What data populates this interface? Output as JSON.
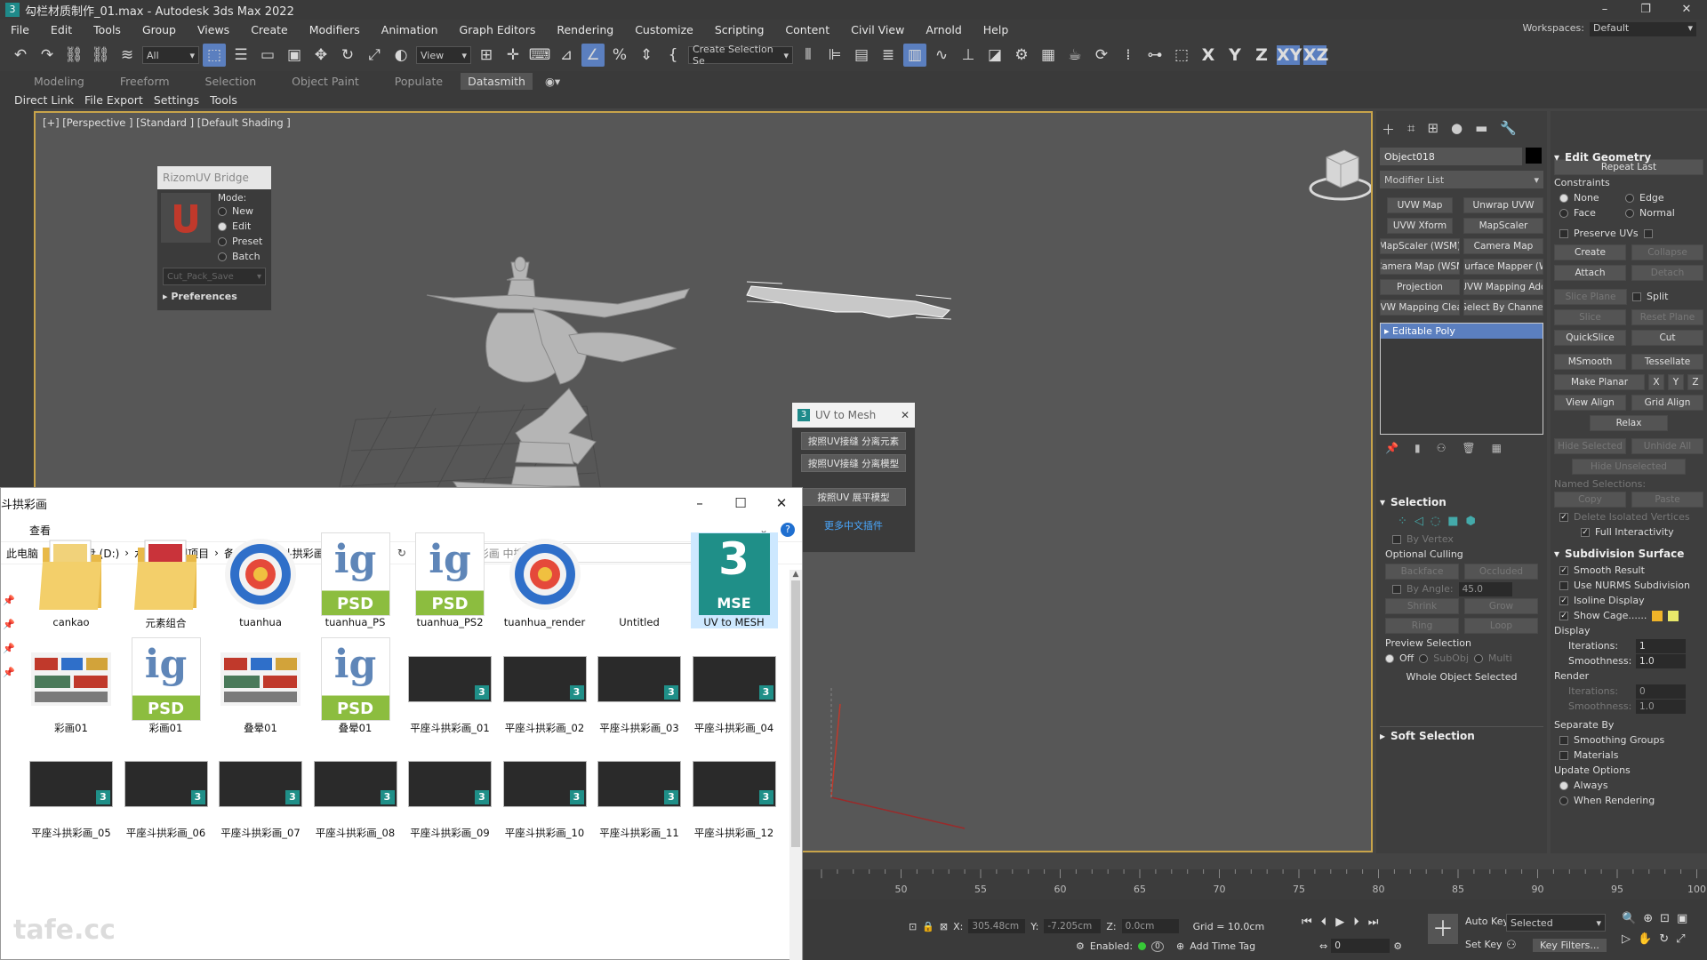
{
  "window": {
    "title": "勾栏材质制作_01.max - Autodesk 3ds Max 2022",
    "app_icon": "3",
    "controls": [
      "–",
      "❐",
      "✕"
    ]
  },
  "menu": [
    "File",
    "Edit",
    "Tools",
    "Group",
    "Views",
    "Create",
    "Modifiers",
    "Animation",
    "Graph Editors",
    "Rendering",
    "Customize",
    "Scripting",
    "Content",
    "Civil View",
    "Arnold",
    "Help"
  ],
  "workspaces": {
    "label": "Workspaces:",
    "value": "Default"
  },
  "toolbar": {
    "filter": "All",
    "view": "View",
    "selection_set": "Create Selection Se",
    "axes": [
      "X",
      "Y",
      "Z",
      "XY",
      "XZ"
    ]
  },
  "ribbon_tabs": [
    "Modeling",
    "Freeform",
    "Selection",
    "Object Paint",
    "Populate",
    "Datasmith"
  ],
  "subbar": [
    "Direct Link",
    "File Export",
    "Settings",
    "Tools"
  ],
  "viewport": {
    "label": "[+] [Perspective ] [Standard ] [Default Shading ]"
  },
  "rizom": {
    "title": "RizomUV Bridge",
    "mode_label": "Mode:",
    "modes": [
      "New",
      "Edit",
      "Preset",
      "Batch"
    ],
    "selected": "Edit",
    "dropdown": "Cut_Pack_Save",
    "preferences": "Preferences"
  },
  "uvmesh": {
    "title": "UV to Mesh",
    "buttons": [
      "按照UV接缝 分离元素",
      "按照UV接缝 分离模型",
      "按照UV 展平模型"
    ],
    "link": "更多中文插件"
  },
  "command_panel": {
    "object_name": "Object018",
    "modifier_list": "Modifier List",
    "buttons": [
      "UVW Map",
      "Unwrap UVW",
      "UVW Xform",
      "MapScaler",
      "MapScaler (WSM)",
      "Camera Map",
      "Camera Map (WSM",
      "Surface Mapper (W",
      "Projection",
      "UVW Mapping Add",
      "UVW Mapping Clear",
      "Select By Channel"
    ],
    "stack_item": "Editable Poly",
    "selection": {
      "title": "Selection",
      "by_vertex": "By Vertex",
      "optional_culling": "Optional Culling",
      "backface": "Backface",
      "occluded": "Occluded",
      "by_angle": "By Angle:",
      "angle": "45.0",
      "shrink": "Shrink",
      "grow": "Grow",
      "ring": "Ring",
      "loop": "Loop",
      "preview": "Preview Selection",
      "off": "Off",
      "subobj": "SubObj",
      "multi": "Multi",
      "status": "Whole Object Selected"
    },
    "soft_selection": "Soft Selection"
  },
  "edit_geometry": {
    "title": "Edit Geometry",
    "repeat_last": "Repeat Last",
    "constraints": "Constraints",
    "c_opts": [
      "None",
      "Edge",
      "Face",
      "Normal"
    ],
    "preserve_uvs": "Preserve UVs",
    "create": "Create",
    "collapse": "Collapse",
    "attach": "Attach",
    "detach": "Detach",
    "slice_plane": "Slice Plane",
    "split": "Split",
    "slice": "Slice",
    "reset_plane": "Reset Plane",
    "quickslice": "QuickSlice",
    "cut": "Cut",
    "msmooth": "MSmooth",
    "tessellate": "Tessellate",
    "make_planar": "Make Planar",
    "x": "X",
    "y": "Y",
    "z": "Z",
    "view_align": "View Align",
    "grid_align": "Grid Align",
    "relax": "Relax",
    "hide_selected": "Hide Selected",
    "unhide_all": "Unhide All",
    "hide_unselected": "Hide Unselected",
    "named_selections": "Named Selections:",
    "copy": "Copy",
    "paste": "Paste",
    "delete_isolated": "Delete Isolated Vertices",
    "full_interactivity": "Full Interactivity"
  },
  "subdivision": {
    "title": "Subdivision Surface",
    "smooth_result": "Smooth Result",
    "use_nurms": "Use NURMS Subdivision",
    "isoline": "Isoline Display",
    "show_cage": "Show Cage......",
    "cage_colors": [
      "#f0b429",
      "#e8e86a"
    ],
    "display": "Display",
    "iterations": "Iterations:",
    "iter_val": "1",
    "smoothness": "Smoothness:",
    "smooth_val": "1.0",
    "render": "Render",
    "r_iter_val": "0",
    "r_smooth_val": "1.0",
    "separate_by": "Separate By",
    "smoothing_groups": "Smoothing Groups",
    "materials": "Materials",
    "update_options": "Update Options",
    "always": "Always",
    "when_rendering": "When Rendering"
  },
  "explorer": {
    "title": "斗拱彩画",
    "view_tab": "查看",
    "crumbs": [
      "此电脑",
      "本地磁盘 (D:)",
      "水殿招凉图项目",
      "备课",
      "平座斗拱彩画"
    ],
    "search_placeholder": "在 平座斗拱彩画 中搜索",
    "items": [
      "cankao",
      "元素组合",
      "tuanhua",
      "tuanhua_PS",
      "tuanhua_PS2",
      "tuanhua_render",
      "Untitled",
      "UV to MESH",
      "彩画01",
      "彩画01",
      "叠晕01",
      "叠晕01",
      "平座斗拱彩画_01",
      "平座斗拱彩画_02",
      "平座斗拱彩画_03",
      "平座斗拱彩画_04",
      "平座斗拱彩画_05",
      "平座斗拱彩画_06",
      "平座斗拱彩画_07",
      "平座斗拱彩画_08",
      "平座斗拱彩画_09",
      "平座斗拱彩画_10",
      "平座斗拱彩画_11",
      "平座斗拱彩画_12"
    ],
    "psd_label": "PSD",
    "ig_label": "ig",
    "mse_label": "MSE",
    "max_badge": "3"
  },
  "timeline": {
    "ticks": [
      "50",
      "55",
      "60",
      "65",
      "70",
      "75",
      "80",
      "85",
      "90",
      "95",
      "100"
    ]
  },
  "status": {
    "x_label": "X:",
    "x": "305.48cm",
    "y_label": "Y:",
    "y": "-7.205cm",
    "z_label": "Z:",
    "z": "0.0cm",
    "grid": "Grid = 10.0cm",
    "enabled": "Enabled:",
    "enabled_val": "0",
    "add_time_tag": "Add Time Tag",
    "auto_key": "Auto Key",
    "set_key": "Set Key",
    "selected": "Selected",
    "key_filters": "Key Filters...",
    "frame": "0"
  },
  "watermark": "tafe.cc"
}
